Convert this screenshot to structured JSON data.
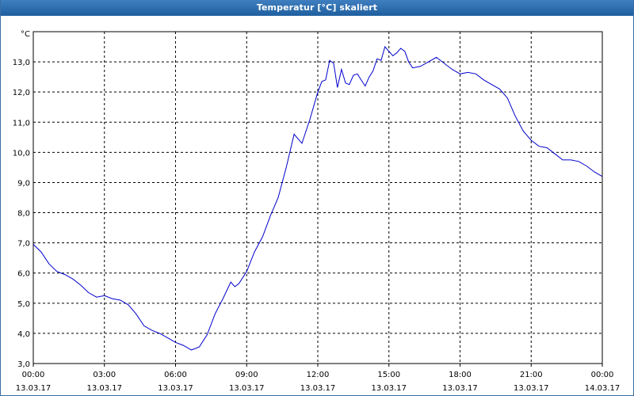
{
  "window": {
    "title": "Temperatur [°C] skaliert"
  },
  "chart_data": {
    "type": "line",
    "title": "Temperatur [°C] skaliert",
    "ylabel": "°C",
    "xlabel": "",
    "ylim": [
      3.0,
      14.0
    ],
    "xlim": [
      0,
      24
    ],
    "grid": true,
    "y_ticks": [
      "3,0",
      "4,0",
      "5,0",
      "6,0",
      "7,0",
      "8,0",
      "9,0",
      "10,0",
      "11,0",
      "12,0",
      "13,0"
    ],
    "x_ticks": [
      {
        "time": "00:00",
        "date": "13.03.17"
      },
      {
        "time": "03:00",
        "date": "13.03.17"
      },
      {
        "time": "06:00",
        "date": "13.03.17"
      },
      {
        "time": "09:00",
        "date": "13.03.17"
      },
      {
        "time": "12:00",
        "date": "13.03.17"
      },
      {
        "time": "15:00",
        "date": "13.03.17"
      },
      {
        "time": "18:00",
        "date": "13.03.17"
      },
      {
        "time": "21:00",
        "date": "13.03.17"
      },
      {
        "time": "00:00",
        "date": "14.03.17"
      }
    ],
    "line_color": "#0000cc",
    "series": [
      {
        "x": [
          0.0,
          0.33,
          0.67,
          1.0,
          1.33,
          1.67,
          2.0,
          2.33,
          2.67,
          3.0,
          3.33,
          3.67,
          4.0,
          4.33,
          4.67,
          5.0,
          5.33,
          5.67,
          6.0,
          6.33,
          6.67,
          7.0,
          7.33,
          7.67,
          8.0,
          8.33,
          8.5,
          8.67,
          9.0,
          9.33,
          9.67,
          10.0,
          10.33,
          10.67,
          11.0,
          11.33,
          11.67,
          12.0,
          12.17,
          12.33,
          12.5,
          12.67,
          12.83,
          13.0,
          13.17,
          13.33,
          13.5,
          13.67,
          13.83,
          14.0,
          14.17,
          14.33,
          14.5,
          14.67,
          14.83,
          15.0,
          15.17,
          15.33,
          15.5,
          15.67,
          15.83,
          16.0,
          16.33,
          16.67,
          17.0,
          17.33,
          17.67,
          18.0,
          18.33,
          18.67,
          19.0,
          19.33,
          19.67,
          20.0,
          20.33,
          20.67,
          21.0,
          21.33,
          21.67,
          22.0,
          22.33,
          22.67,
          23.0,
          23.33,
          23.67,
          24.0
        ],
        "y": [
          6.95,
          6.7,
          6.3,
          6.05,
          5.95,
          5.8,
          5.6,
          5.35,
          5.2,
          5.25,
          5.15,
          5.1,
          4.95,
          4.65,
          4.25,
          4.1,
          4.0,
          3.85,
          3.7,
          3.6,
          3.45,
          3.55,
          3.95,
          4.65,
          5.15,
          5.7,
          5.55,
          5.65,
          6.05,
          6.7,
          7.2,
          7.9,
          8.5,
          9.5,
          10.6,
          10.3,
          11.1,
          12.0,
          12.35,
          12.4,
          13.05,
          12.95,
          12.15,
          12.75,
          12.3,
          12.25,
          12.55,
          12.6,
          12.4,
          12.2,
          12.5,
          12.7,
          13.1,
          13.05,
          13.5,
          13.35,
          13.2,
          13.3,
          13.45,
          13.35,
          13.0,
          12.8,
          12.85,
          13.0,
          13.15,
          12.95,
          12.75,
          12.6,
          12.65,
          12.6,
          12.4,
          12.25,
          12.1,
          11.8,
          11.2,
          10.7,
          10.4,
          10.2,
          10.15,
          9.95,
          9.75,
          9.75,
          9.7,
          9.55,
          9.35,
          9.2
        ]
      }
    ]
  }
}
